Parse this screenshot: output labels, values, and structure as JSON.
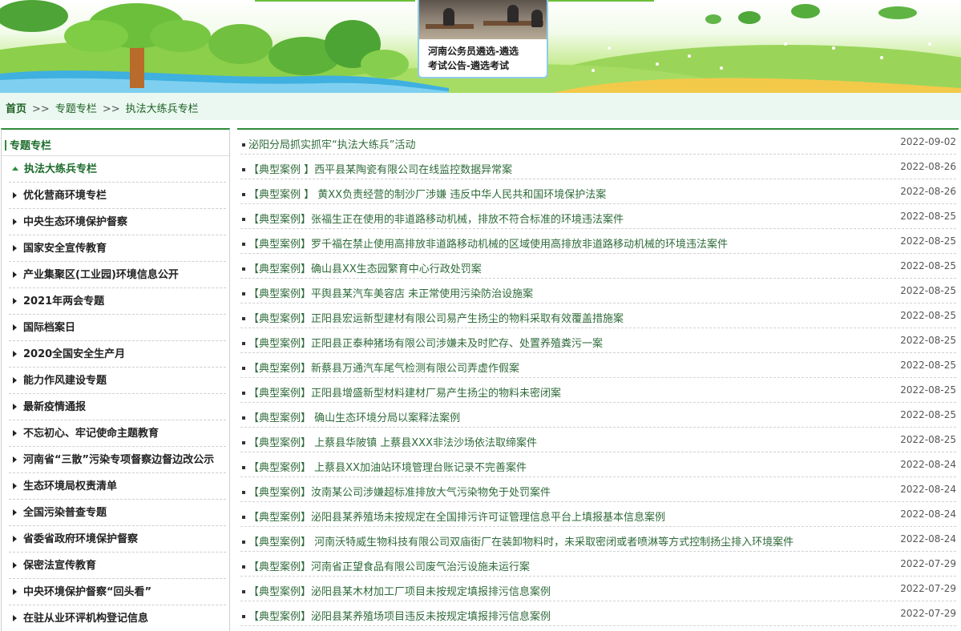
{
  "banner": {
    "ad_text_line1": "河南公务员遴选-遴选",
    "ad_text_line2": "考试公告-遴选考试"
  },
  "breadcrumb": {
    "home": "首页",
    "sep1": ">>",
    "level1": "专题专栏",
    "sep2": ">>",
    "level2": "执法大练兵专栏"
  },
  "sidebar": {
    "title": "专题专栏",
    "items": [
      {
        "label": "执法大练兵专栏",
        "active": true
      },
      {
        "label": "优化营商环境专栏"
      },
      {
        "label": "中央生态环境保护督察"
      },
      {
        "label": "国家安全宣传教育"
      },
      {
        "label": "产业集聚区(工业园)环境信息公开"
      },
      {
        "label": "2021年两会专题"
      },
      {
        "label": "国际档案日"
      },
      {
        "label": "2020全国安全生产月"
      },
      {
        "label": "能力作风建设专题"
      },
      {
        "label": "最新疫情通报"
      },
      {
        "label": "不忘初心、牢记使命主题教育"
      },
      {
        "label": "河南省“三散”污染专项督察边督边改公示"
      },
      {
        "label": "生态环境局权责清单"
      },
      {
        "label": "全国污染普查专题"
      },
      {
        "label": "省委省政府环境保护督察"
      },
      {
        "label": "保密法宣传教育"
      },
      {
        "label": "中央环境保护督察“回头看”"
      },
      {
        "label": "在驻从业环评机构登记信息"
      }
    ]
  },
  "articles": [
    {
      "title": "泌阳分局抓实抓牢“执法大练兵”活动",
      "date": "2022-09-02"
    },
    {
      "title": "【典型案例 】西平县某陶瓷有限公司在线监控数据异常案",
      "date": "2022-08-26"
    },
    {
      "title": "【典型案例 】 黄XX负责经营的制沙厂涉嫌 违反中华人民共和国环境保护法案",
      "date": "2022-08-26"
    },
    {
      "title": "【典型案例】张福生正在使用的非道路移动机械，排放不符合标准的环境违法案件",
      "date": "2022-08-25"
    },
    {
      "title": "【典型案例】罗千福在禁止使用高排放非道路移动机械的区域使用高排放非道路移动机械的环境违法案件",
      "date": "2022-08-25"
    },
    {
      "title": "【典型案例】确山县XX生态园繁育中心行政处罚案",
      "date": "2022-08-25"
    },
    {
      "title": "【典型案例】平舆县某汽车美容店 未正常使用污染防治设施案",
      "date": "2022-08-25"
    },
    {
      "title": "【典型案例】正阳县宏运新型建材有限公司易产生扬尘的物料采取有效覆盖措施案",
      "date": "2022-08-25"
    },
    {
      "title": "【典型案例】正阳县正泰种猪场有限公司涉嫌未及时贮存、处置养殖粪污一案",
      "date": "2022-08-25"
    },
    {
      "title": "【典型案例】新蔡县万通汽车尾气检测有限公司弄虚作假案",
      "date": "2022-08-25"
    },
    {
      "title": "【典型案例】正阳县增盛新型材料建材厂易产生扬尘的物料未密闭案",
      "date": "2022-08-25"
    },
    {
      "title": "【典型案例】 确山生态环境分局以案释法案例",
      "date": "2022-08-25"
    },
    {
      "title": "【典型案例】 上蔡县华陂镇 上蔡县XXX非法沙场依法取缔案件",
      "date": "2022-08-25"
    },
    {
      "title": "【典型案例】 上蔡县XX加油站环境管理台账记录不完善案件",
      "date": "2022-08-24"
    },
    {
      "title": "【典型案例】汝南某公司涉嫌超标准排放大气污染物免于处罚案件",
      "date": "2022-08-24"
    },
    {
      "title": "【典型案例】泌阳县某养殖场未按规定在全国排污许可证管理信息平台上填报基本信息案例",
      "date": "2022-08-24"
    },
    {
      "title": "【典型案例】 河南沃特威生物科技有限公司双庙街厂在装卸物料时，未采取密闭或者喷淋等方式控制扬尘排入环境案件",
      "date": "2022-08-24"
    },
    {
      "title": "【典型案例】河南省正望食品有限公司废气治污设施未运行案",
      "date": "2022-07-29"
    },
    {
      "title": "【典型案例】泌阳县某木材加工厂项目未按规定填报排污信息案例",
      "date": "2022-07-29"
    },
    {
      "title": "【典型案例】泌阳县某养殖场项目违反未按规定填报排污信息案例",
      "date": "2022-07-29"
    }
  ]
}
